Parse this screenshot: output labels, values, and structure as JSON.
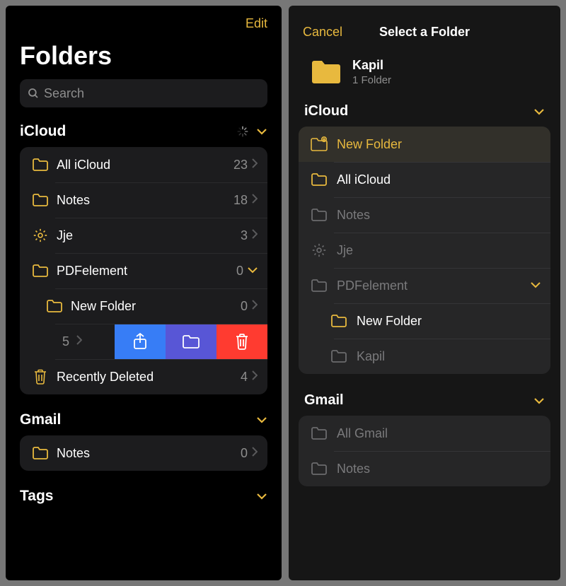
{
  "colors": {
    "accent": "#e8b93e",
    "bg_card": "#1c1c1e"
  },
  "left": {
    "edit_label": "Edit",
    "title": "Folders",
    "search_placeholder": "Search",
    "sections": {
      "icloud": {
        "title": "iCloud",
        "items": [
          {
            "icon": "folder",
            "label": "All iCloud",
            "count": "23",
            "chevron": "right"
          },
          {
            "icon": "folder",
            "label": "Notes",
            "count": "18",
            "chevron": "right"
          },
          {
            "icon": "gear",
            "label": "Jje",
            "count": "3",
            "chevron": "right"
          },
          {
            "icon": "folder",
            "label": "PDFelement",
            "count": "0",
            "chevron": "down"
          },
          {
            "icon": "folder",
            "label": "New Folder",
            "count": "0",
            "chevron": "right",
            "indent": true
          },
          {
            "preview_count": "5",
            "swipe": true
          },
          {
            "icon": "trash",
            "label": "Recently Deleted",
            "count": "4",
            "chevron": "right"
          }
        ]
      },
      "gmail": {
        "title": "Gmail",
        "items": [
          {
            "icon": "folder",
            "label": "Notes",
            "count": "0",
            "chevron": "right"
          }
        ]
      },
      "tags": {
        "title": "Tags"
      }
    }
  },
  "right": {
    "cancel_label": "Cancel",
    "title": "Select a Folder",
    "context": {
      "name": "Kapil",
      "subtitle": "1 Folder"
    },
    "sections": {
      "icloud": {
        "title": "iCloud",
        "items": [
          {
            "icon": "new-folder",
            "label": "New Folder",
            "state": "active",
            "highlight": true
          },
          {
            "icon": "folder",
            "label": "All iCloud",
            "state": "enabled"
          },
          {
            "icon": "folder-dim",
            "label": "Notes",
            "state": "disabled"
          },
          {
            "icon": "gear-dim",
            "label": "Jje",
            "state": "disabled"
          },
          {
            "icon": "folder-dim",
            "label": "PDFelement",
            "state": "disabled",
            "chevron": "down"
          },
          {
            "icon": "folder",
            "label": "New Folder",
            "state": "enabled",
            "indent": true
          },
          {
            "icon": "folder-dim",
            "label": "Kapil",
            "state": "disabled",
            "indent": true
          }
        ]
      },
      "gmail": {
        "title": "Gmail",
        "items": [
          {
            "icon": "folder-dim",
            "label": "All Gmail",
            "state": "disabled"
          },
          {
            "icon": "folder-dim",
            "label": "Notes",
            "state": "disabled"
          }
        ]
      }
    }
  }
}
